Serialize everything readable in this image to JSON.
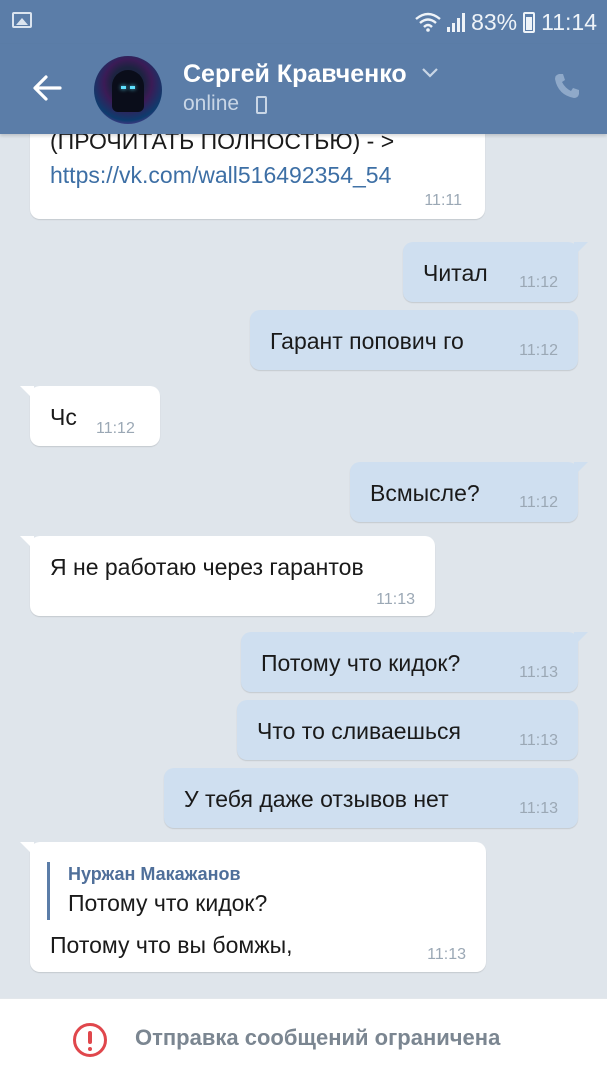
{
  "status_bar": {
    "battery_percent": "83%",
    "time": "11:14",
    "icons": [
      "gallery-icon",
      "wifi-icon",
      "signal-icon",
      "battery-icon"
    ]
  },
  "header": {
    "contact_name": "Сергей Кравченко",
    "status": "online",
    "icons": [
      "back-arrow-icon",
      "chevron-down-icon",
      "mobile-device-icon",
      "phone-call-icon"
    ]
  },
  "messages": [
    {
      "direction": "in",
      "lines": [
        "(ПРОЧИТАТЬ ПОЛНОСТЬЮ) - >",
        "https://vk.com/wall516492354_54"
      ],
      "time": "11:11"
    },
    {
      "direction": "out",
      "text": "Читал",
      "time": "11:12"
    },
    {
      "direction": "out",
      "text": "Гарант попович го",
      "time": "11:12"
    },
    {
      "direction": "in",
      "text": "Чс",
      "time": "11:12"
    },
    {
      "direction": "out",
      "text": "Всмысле?",
      "time": "11:12"
    },
    {
      "direction": "in",
      "text": "Я не работаю через гарантов",
      "time": "11:13"
    },
    {
      "direction": "out",
      "text": "Потому что кидок?",
      "time": "11:13"
    },
    {
      "direction": "out",
      "text": "Что то сливаешься",
      "time": "11:13"
    },
    {
      "direction": "out",
      "text": "У тебя даже отзывов нет",
      "time": "11:13"
    },
    {
      "direction": "in",
      "reply_author": "Нуржан Макажанов",
      "reply_text": "Потому что кидок?",
      "text": "Потому что вы бомжы,",
      "time": "11:13"
    }
  ],
  "footer": {
    "notice": "Отправка сообщений ограничена",
    "icon": "warning-icon"
  },
  "colors": {
    "header_bg": "#5b7da8",
    "chat_bg": "#dfe5eb",
    "incoming_bubble": "#ffffff",
    "outgoing_bubble": "#cfdff0",
    "link": "#3d6fa5",
    "warning": "#e0474c"
  }
}
